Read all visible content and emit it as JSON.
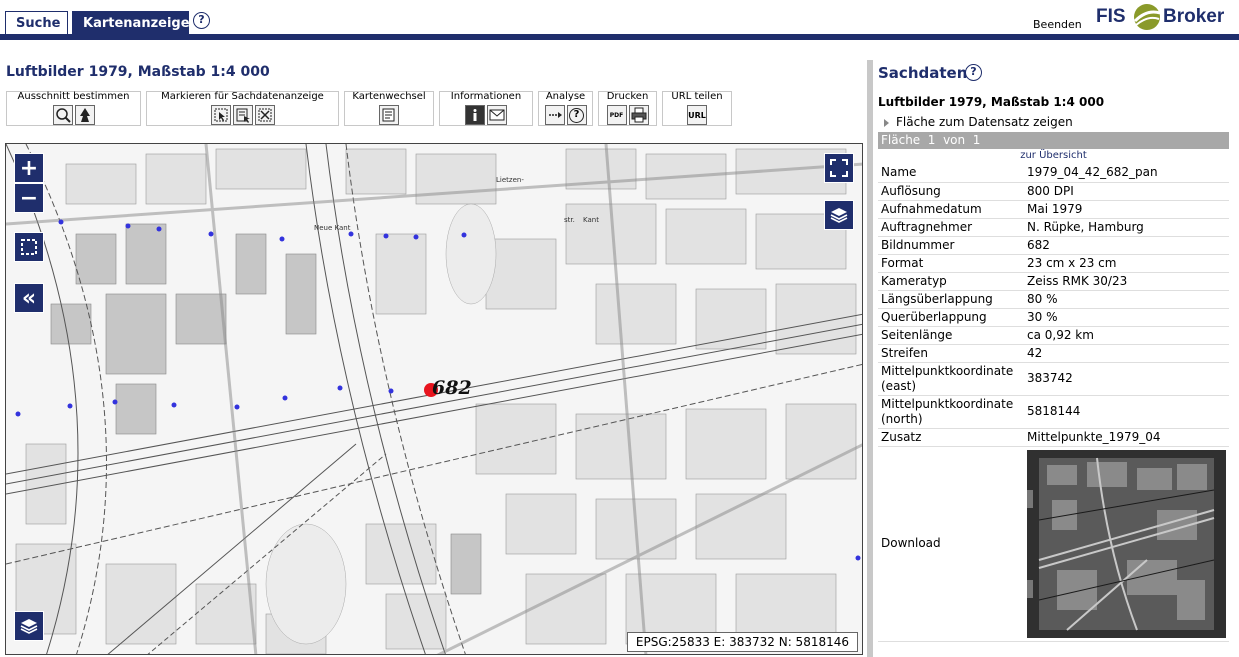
{
  "tabs": {
    "search": "Suche",
    "map": "Kartenanzeige"
  },
  "header": {
    "help": "?",
    "logout": "Beenden",
    "logo_left": "FIS",
    "logo_right": "Broker"
  },
  "map_title": "Luftbilder 1979, Maßstab 1:4 000",
  "toolbar": {
    "groups": [
      {
        "label": "Ausschnitt bestimmen"
      },
      {
        "label": "Markieren für Sachdatenanzeige"
      },
      {
        "label": "Kartenwechsel"
      },
      {
        "label": "Informationen"
      },
      {
        "label": "Analyse"
      },
      {
        "label": "Drucken"
      },
      {
        "label": "URL teilen"
      }
    ],
    "analyse_icon_text": "?",
    "pdf_text": "PDF",
    "url_text": "URL"
  },
  "map": {
    "zoom_in": "+",
    "zoom_out": "−",
    "collapse": "«",
    "marker_label": "682",
    "street_labels": [
      "Lietzen-",
      "Neue Kant",
      "str.",
      "Kant"
    ],
    "coordinate_readout": "EPSG:25833 E: 383732 N: 5818146"
  },
  "panel": {
    "title": "Sachdaten",
    "help": "?",
    "subtitle": "Luftbilder 1979, Maßstab 1:4 000",
    "show_area_link": "Fläche zum Datensatz zeigen",
    "count": "Fläche  1  von  1",
    "overview_link": "zur Übersicht",
    "attributes": [
      {
        "key": "Name",
        "value": "1979_04_42_682_pan"
      },
      {
        "key": "Auflösung",
        "value": "800 DPI"
      },
      {
        "key": "Aufnahmedatum",
        "value": "Mai 1979"
      },
      {
        "key": "Auftragnehmer",
        "value": "N. Rüpke, Hamburg"
      },
      {
        "key": "Bildnummer",
        "value": "682"
      },
      {
        "key": "Format",
        "value": "23 cm x 23 cm"
      },
      {
        "key": "Kameratyp",
        "value": "Zeiss RMK 30/23"
      },
      {
        "key": "Längsüberlappung",
        "value": "80 %"
      },
      {
        "key": "Querüberlappung",
        "value": "30 %"
      },
      {
        "key": "Seitenlänge",
        "value": "ca 0,92 km"
      },
      {
        "key": "Streifen",
        "value": "42"
      },
      {
        "key": "Mittelpunktkoordinate (east)",
        "value": "383742"
      },
      {
        "key": "Mittelpunktkoordinate (north)",
        "value": "5818144"
      },
      {
        "key": "Zusatz",
        "value": "Mittelpunkte_1979_04"
      }
    ],
    "download_label": "Download"
  },
  "colors": {
    "brand": "#1f2e6c",
    "logo_accent": "#8a9a2a",
    "marker": "#e8141e",
    "point": "#3333dd"
  }
}
